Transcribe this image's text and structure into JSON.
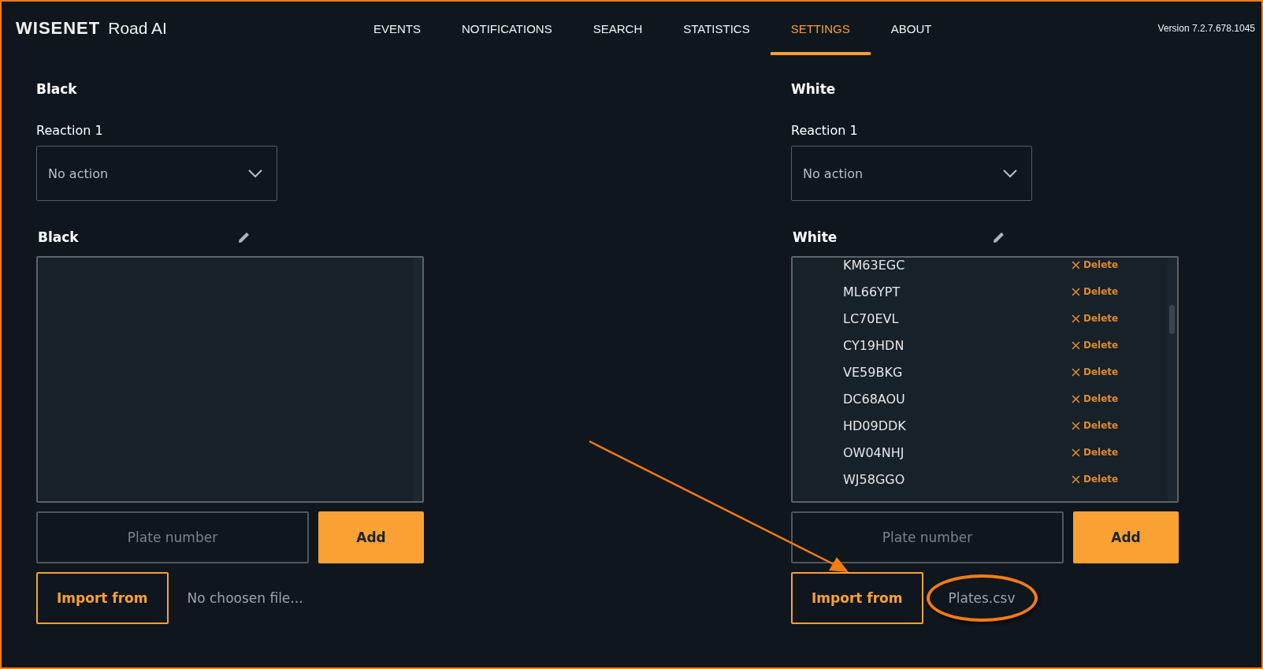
{
  "header": {
    "logo": "WISENET",
    "product": "Road AI",
    "version": "Version 7.2.7.678.1045"
  },
  "tabs": [
    {
      "label": "EVENTS",
      "selected": false
    },
    {
      "label": "NOTIFICATIONS",
      "selected": false
    },
    {
      "label": "SEARCH",
      "selected": false
    },
    {
      "label": "STATISTICS",
      "selected": false
    },
    {
      "label": "SETTINGS",
      "selected": true
    },
    {
      "label": "ABOUT",
      "selected": false
    }
  ],
  "lists": [
    {
      "title": "Black",
      "reaction_label": "Reaction 1",
      "reaction_value": "No action",
      "list_title": "Black",
      "placeholder": "Plate number",
      "add_button": "Add",
      "import_button": "Import from",
      "file_name": "No choosen file...",
      "file_highlighted": false
    },
    {
      "title": "White",
      "reaction_label": "Reaction 1",
      "reaction_value": "No action",
      "list_title": "White",
      "plates": [
        {
          "plate": "KM63EGC",
          "action": "Delete"
        },
        {
          "plate": "ML66YPT",
          "action": "Delete"
        },
        {
          "plate": "LC70EVL",
          "action": "Delete"
        },
        {
          "plate": "CY19HDN",
          "action": "Delete"
        },
        {
          "plate": "VE59BKG",
          "action": "Delete"
        },
        {
          "plate": "DC68AOU",
          "action": "Delete"
        },
        {
          "plate": "HD09DDK",
          "action": "Delete"
        },
        {
          "plate": "OW04NHJ",
          "action": "Delete"
        },
        {
          "plate": "WJ58GGO",
          "action": "Delete"
        }
      ],
      "placeholder": "Plate number",
      "add_button": "Add",
      "import_button": "Import from",
      "file_name": "Plates.csv",
      "file_highlighted": true
    }
  ]
}
